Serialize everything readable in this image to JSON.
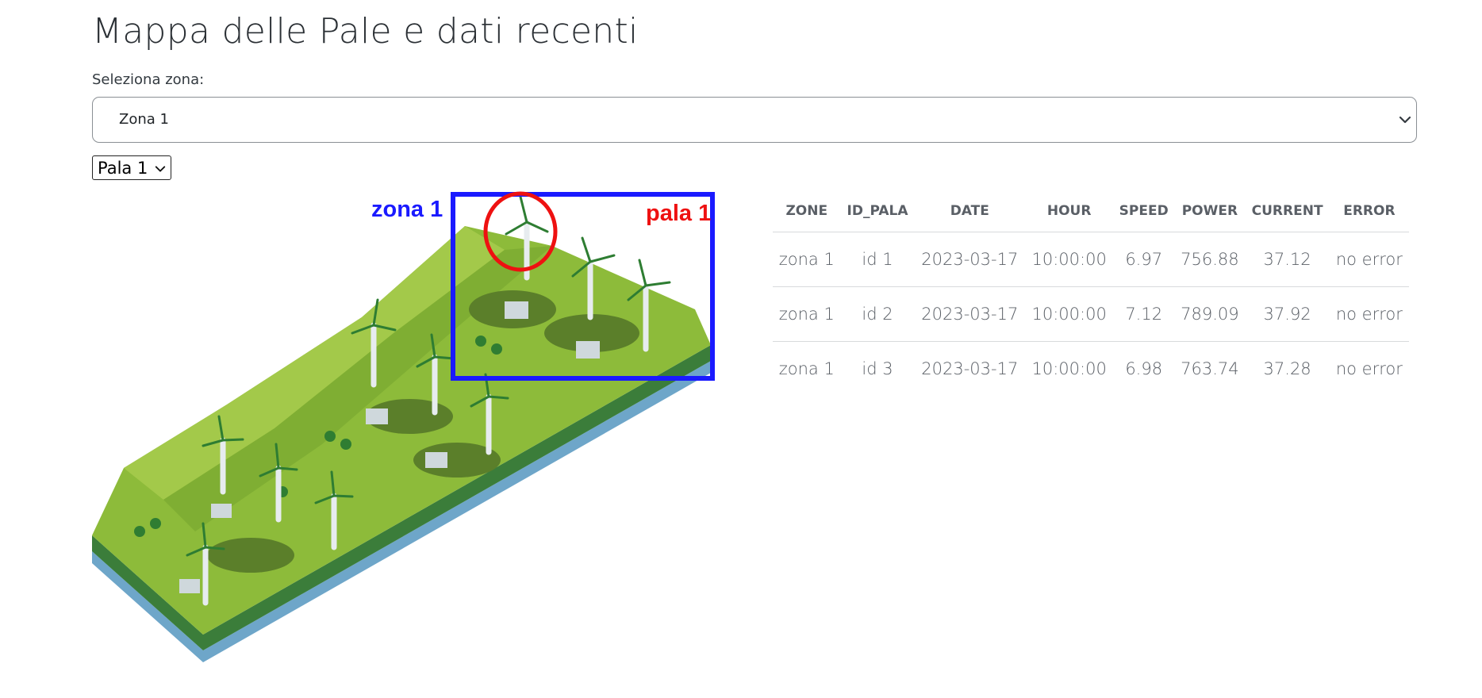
{
  "header": {
    "title": "Mappa delle Pale e dati recenti"
  },
  "zone_selector": {
    "label": "Seleziona zona:",
    "selected": "Zona 1"
  },
  "pala_selector": {
    "selected": "Pala 1"
  },
  "map": {
    "zone_label": "zona 1",
    "pala_label": "pala 1",
    "zone_highlight_color": "#1a1aff",
    "pala_highlight_color": "#ee1111"
  },
  "table": {
    "columns": [
      "ZONE",
      "ID_PALA",
      "DATE",
      "HOUR",
      "SPEED",
      "POWER",
      "CURRENT",
      "ERROR"
    ],
    "rows": [
      [
        "zona 1",
        "id 1",
        "2023-03-17",
        "10:00:00",
        "6.97",
        "756.88",
        "37.12",
        "no error"
      ],
      [
        "zona 1",
        "id 2",
        "2023-03-17",
        "10:00:00",
        "7.12",
        "789.09",
        "37.92",
        "no error"
      ],
      [
        "zona 1",
        "id 3",
        "2023-03-17",
        "10:00:00",
        "6.98",
        "763.74",
        "37.28",
        "no error"
      ]
    ]
  }
}
